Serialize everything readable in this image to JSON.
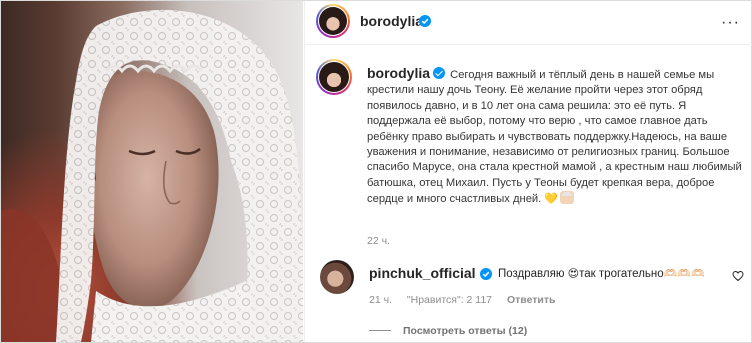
{
  "post": {
    "author": "borodylia",
    "photo_description_icon": "photo"
  },
  "caption": {
    "username": "borodylia",
    "text": "Сегодня важный и тёплый день в нашей семье мы крестили нашу дочь Теону. Её желание пройти через этот обряд появилось давно, и в 10 лет она сама решила: это её путь. Я поддержала её выбор, потому что верю , что самое главное дать ребёнку право выбирать и чувствовать поддержку.Надеюсь, на ваше уважения и понимание, независимо от религиозных границ. Большое спасибо Марусе, она стала крестной мамой , а крестным наш любимый батюшка, отец Михаил. Пусть у Теоны будет крепкая вера, доброе сердце и много счастливых дней.",
    "emoji_heart": "💛",
    "time": "22 ч."
  },
  "comment": {
    "username": "pinchuk_official",
    "text": "Поздравляю ",
    "emoji_smile": "😍",
    "text_after": "так трогательно",
    "trailing_glyphs": "🫶🏻🫶🏻🫶🏻",
    "time": "21 ч.",
    "likes": "\"Нравится\": 2 117",
    "reply_label": "Ответить",
    "view_replies": "Посмотреть ответы (12)"
  },
  "icons": {
    "verified": "verified-badge-icon",
    "more": "more-options-icon",
    "like": "heart-outline-icon"
  },
  "colors": {
    "verified": "#0095f6",
    "text": "#262626",
    "muted": "#8e8e8e"
  }
}
